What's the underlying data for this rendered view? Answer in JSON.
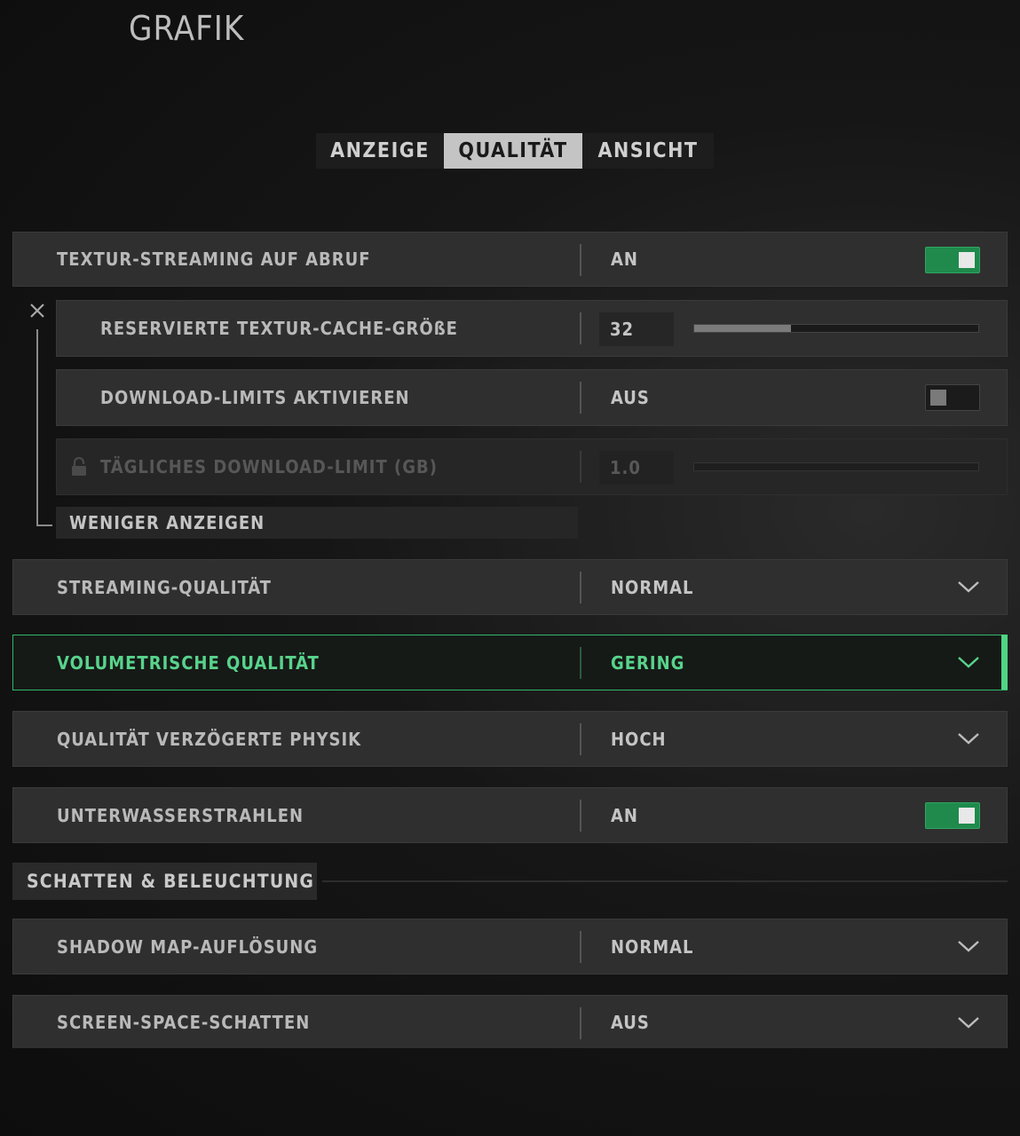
{
  "page": {
    "title": "GRAFIK"
  },
  "tabs": [
    {
      "label": "ANZEIGE",
      "active": false
    },
    {
      "label": "QUALITÄT",
      "active": true
    },
    {
      "label": "ANSICHT",
      "active": false
    }
  ],
  "colors": {
    "accent": "#4fd585",
    "toggle_on": "#1f8a4c"
  },
  "settings": {
    "texture_streaming": {
      "label": "TEXTUR-STREAMING AUF ABRUF",
      "value": "AN",
      "toggle": "on"
    },
    "texture_cache": {
      "label": "RESERVIERTE TEXTUR-CACHE-GRÖßE",
      "value": "32",
      "slider_fraction": 0.34
    },
    "download_limits": {
      "label": "DOWNLOAD-LIMITS AKTIVIEREN",
      "value": "AUS",
      "toggle": "off"
    },
    "daily_limit": {
      "label": "TÄGLICHES DOWNLOAD-LIMIT (GB)",
      "value": "1.0",
      "slider_fraction": 0,
      "disabled": true
    },
    "show_less": {
      "label": "WENIGER ANZEIGEN"
    },
    "streaming_quality": {
      "label": "STREAMING-QUALITÄT",
      "value": "NORMAL"
    },
    "volumetric_quality": {
      "label": "VOLUMETRISCHE QUALITÄT",
      "value": "GERING",
      "selected": true
    },
    "deferred_physics": {
      "label": "QUALITÄT VERZÖGERTE PHYSIK",
      "value": "HOCH"
    },
    "underwater_rays": {
      "label": "UNTERWASSERSTRAHLEN",
      "value": "AN",
      "toggle": "on"
    }
  },
  "section_shadows": {
    "title": "SCHATTEN & BELEUCHTUNG",
    "shadow_map": {
      "label": "SHADOW MAP-AUFLÖSUNG",
      "value": "NORMAL"
    },
    "screen_space_shadows": {
      "label": "SCREEN-SPACE-SCHATTEN",
      "value": "AUS"
    }
  }
}
